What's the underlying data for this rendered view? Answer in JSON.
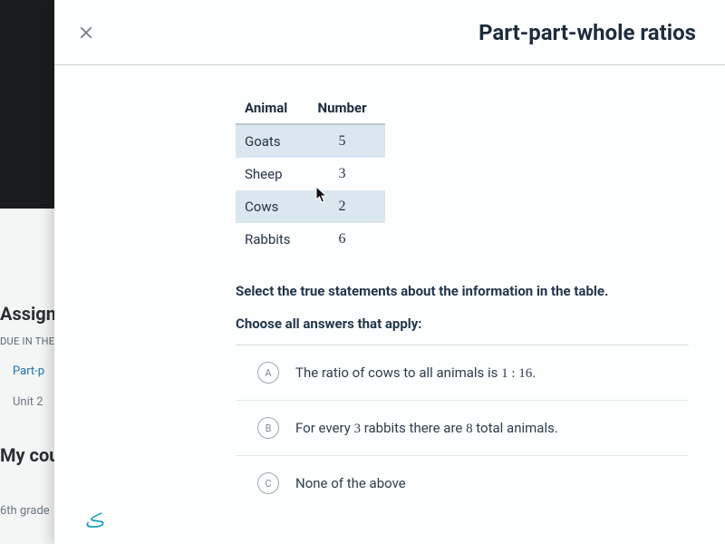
{
  "background": {
    "assign_heading": "Assign",
    "due_label": "DUE IN THE",
    "link1": "Part-p",
    "link2": "Unit 2",
    "courses_heading": "My cou",
    "grade": "6th grade"
  },
  "modal": {
    "title": "Part-part-whole ratios",
    "table": {
      "headers": [
        "Animal",
        "Number"
      ],
      "rows": [
        {
          "animal": "Goats",
          "number": "5",
          "striped": true
        },
        {
          "animal": "Sheep",
          "number": "3",
          "striped": false
        },
        {
          "animal": "Cows",
          "number": "2",
          "striped": true
        },
        {
          "animal": "Rabbits",
          "number": "6",
          "striped": false
        }
      ]
    },
    "prompt": "Select the true statements about the information in the table.",
    "subprompt": "Choose all answers that apply:",
    "choices": [
      {
        "letter": "A",
        "text_pre": "The ratio of cows to all animals is ",
        "math": "1 : 16",
        "text_post": "."
      },
      {
        "letter": "B",
        "text_pre": "For every ",
        "math": "3",
        "text_mid": " rabbits there are ",
        "math2": "8",
        "text_post": " total animals."
      },
      {
        "letter": "C",
        "text_pre": "None of the above",
        "math": "",
        "text_post": ""
      }
    ]
  }
}
